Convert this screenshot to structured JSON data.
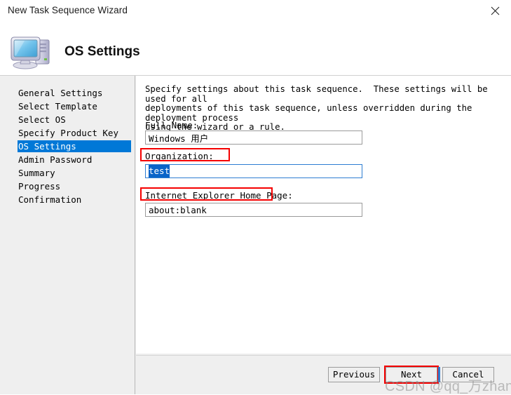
{
  "window": {
    "title": "New Task Sequence Wizard",
    "close_icon": "close-icon"
  },
  "header": {
    "title": "OS Settings",
    "icon": "computer-monitor-icon"
  },
  "sidebar": {
    "items": [
      {
        "label": "General Settings",
        "selected": false
      },
      {
        "label": "Select Template",
        "selected": false
      },
      {
        "label": "Select OS",
        "selected": false
      },
      {
        "label": "Specify Product Key",
        "selected": false
      },
      {
        "label": "OS Settings",
        "selected": true
      },
      {
        "label": "Admin Password",
        "selected": false
      },
      {
        "label": "Summary",
        "selected": false
      },
      {
        "label": "Progress",
        "selected": false
      },
      {
        "label": "Confirmation",
        "selected": false
      }
    ]
  },
  "content": {
    "description": "Specify settings about this task sequence.  These settings will be used for all\ndeployments of this task sequence, unless overridden during the deployment process\nusing the wizard or a rule.",
    "fields": [
      {
        "label": "Full Name:",
        "value": "Windows 用户",
        "placeholder": "",
        "focused": false,
        "annotated": false
      },
      {
        "label": "Organization:",
        "value": "test",
        "placeholder": "",
        "focused": true,
        "annotated": true,
        "selected_text": "test"
      },
      {
        "label": "Internet Explorer Home Page:",
        "value": "about:blank",
        "placeholder": "",
        "focused": false,
        "annotated": true
      }
    ]
  },
  "footer": {
    "buttons": [
      {
        "label": "Previous",
        "annotated": false
      },
      {
        "label": "Next",
        "annotated": true
      },
      {
        "label": "Cancel",
        "annotated": false
      }
    ]
  },
  "watermark": {
    "text": "CSDN @qq_万zhang"
  },
  "colors": {
    "selection_blue": "#0078d7",
    "annotation_red": "#f50000",
    "focus_border": "#2d7dd2",
    "panel_gray": "#efefef",
    "text_black": "#000000"
  }
}
